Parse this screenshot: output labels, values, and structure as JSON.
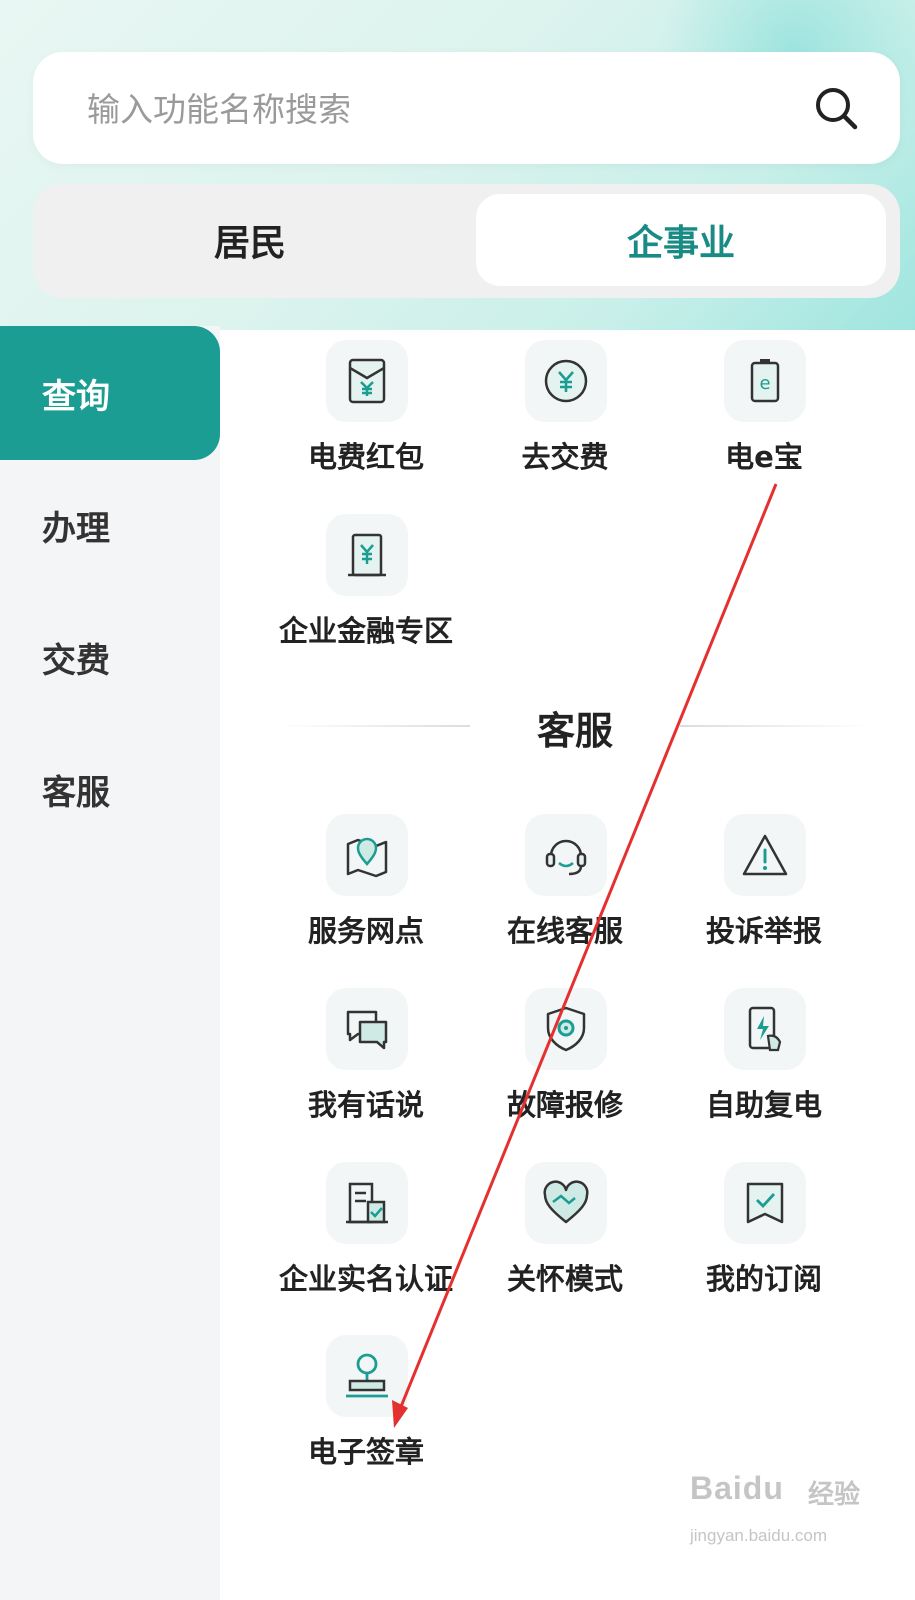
{
  "search": {
    "placeholder": "输入功能名称搜索"
  },
  "tabs": [
    {
      "label": "居民",
      "active": false
    },
    {
      "label": "企事业",
      "active": true
    }
  ],
  "sidebar": {
    "items": [
      {
        "label": "查询",
        "active": true
      },
      {
        "label": "办理",
        "active": false
      },
      {
        "label": "交费",
        "active": false
      },
      {
        "label": "客服",
        "active": false
      }
    ]
  },
  "query_section": {
    "items": [
      {
        "label": "电费红包",
        "icon": "red-envelope-icon"
      },
      {
        "label": "去交费",
        "icon": "yuan-coin-icon"
      },
      {
        "label": "电e宝",
        "icon": "battery-e-icon"
      },
      {
        "label": "企业金融专区",
        "icon": "yuan-building-icon"
      }
    ]
  },
  "service_section": {
    "title": "客服",
    "items": [
      {
        "label": "服务网点",
        "icon": "map-pin-icon"
      },
      {
        "label": "在线客服",
        "icon": "headset-icon"
      },
      {
        "label": "投诉举报",
        "icon": "warning-icon"
      },
      {
        "label": "我有话说",
        "icon": "chat-bubbles-icon"
      },
      {
        "label": "故障报修",
        "icon": "shield-gear-icon"
      },
      {
        "label": "自助复电",
        "icon": "phone-bolt-icon"
      },
      {
        "label": "企业实名认证",
        "icon": "building-check-icon"
      },
      {
        "label": "关怀模式",
        "icon": "heart-hand-icon"
      },
      {
        "label": "我的订阅",
        "icon": "bookmark-check-icon"
      },
      {
        "label": "电子签章",
        "icon": "stamp-icon"
      }
    ]
  },
  "colors": {
    "accent": "#1c9d93",
    "arrow": "#e53030"
  },
  "watermark": {
    "logo": "Baidu",
    "text": "经验",
    "url": "jingyan.baidu.com"
  }
}
